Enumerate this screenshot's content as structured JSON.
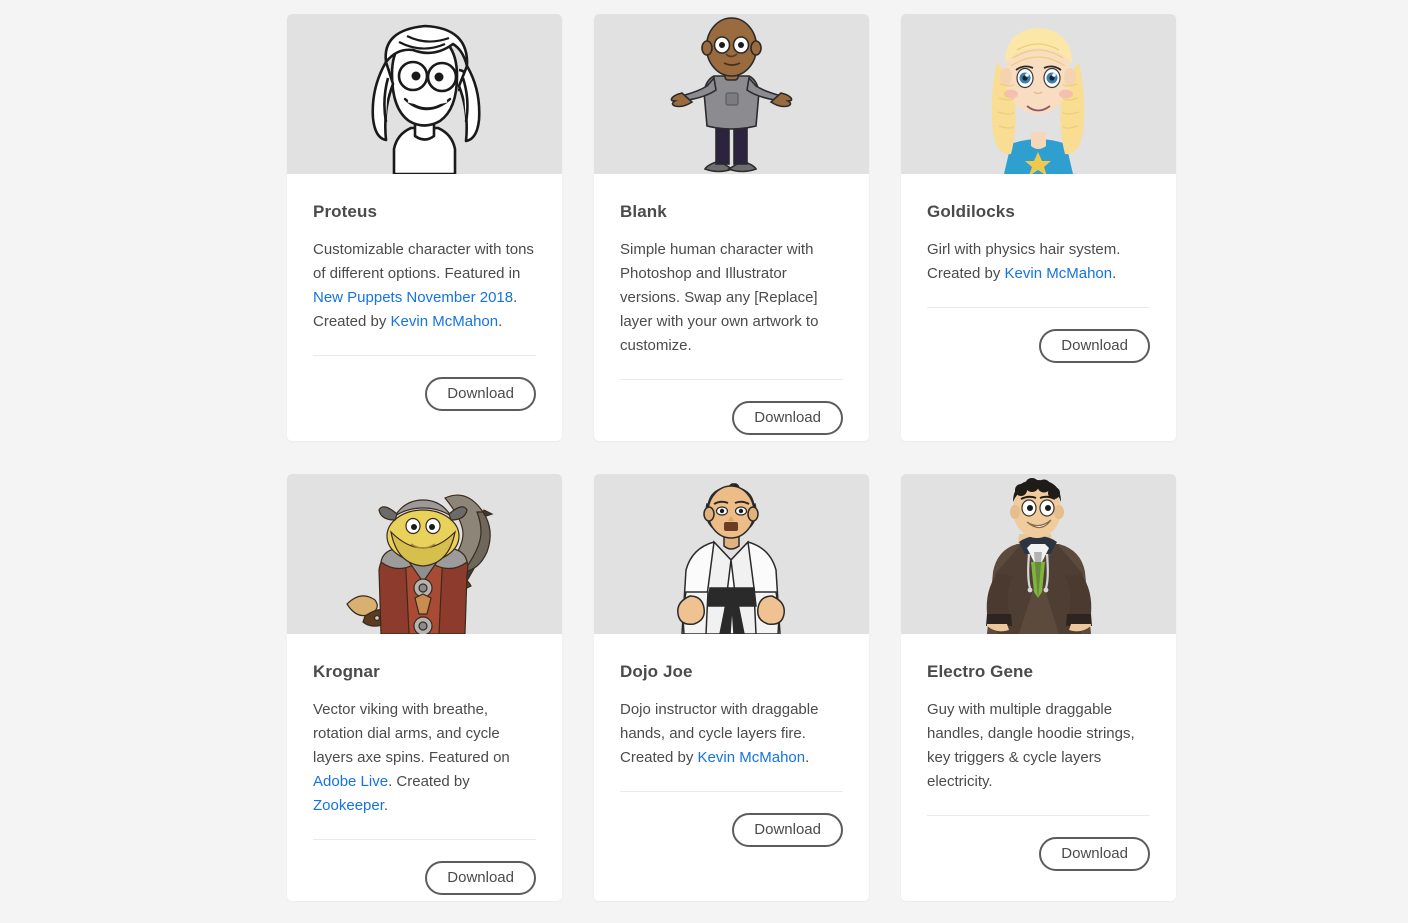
{
  "page": {
    "background_color": "#f4f4f4",
    "card_background_color": "#ffffff",
    "thumbnail_background_color": "#e1e1e1",
    "link_color": "#1473e6",
    "text_color": "#4b4b4b"
  },
  "cards": [
    {
      "title": "Proteus",
      "thumbnail_icon": "proteus-character-thumbnail",
      "description_parts": [
        {
          "type": "text",
          "text": "Customizable character with tons of different options. Featured in "
        },
        {
          "type": "link",
          "text": "New Puppets November 2018"
        },
        {
          "type": "text",
          "text": ". Created by "
        },
        {
          "type": "link",
          "text": "Kevin McMahon"
        },
        {
          "type": "text",
          "text": "."
        }
      ],
      "download_label": "Download"
    },
    {
      "title": "Blank",
      "thumbnail_icon": "blank-character-thumbnail",
      "description_parts": [
        {
          "type": "text",
          "text": "Simple human character with Photoshop and Illustrator versions. Swap any [Replace] layer with your own artwork to customize."
        }
      ],
      "download_label": "Download"
    },
    {
      "title": "Goldilocks",
      "thumbnail_icon": "goldilocks-character-thumbnail",
      "description_parts": [
        {
          "type": "text",
          "text": "Girl with physics hair system. Created by "
        },
        {
          "type": "link",
          "text": "Kevin McMahon"
        },
        {
          "type": "text",
          "text": "."
        }
      ],
      "download_label": "Download"
    },
    {
      "title": "Krognar",
      "thumbnail_icon": "krognar-character-thumbnail",
      "description_parts": [
        {
          "type": "text",
          "text": "Vector viking with breathe, rotation dial arms, and cycle layers axe spins. Featured on "
        },
        {
          "type": "link",
          "text": "Adobe Live"
        },
        {
          "type": "text",
          "text": ". Created by "
        },
        {
          "type": "link",
          "text": "Zookeeper"
        },
        {
          "type": "text",
          "text": "."
        }
      ],
      "download_label": "Download"
    },
    {
      "title": "Dojo Joe",
      "thumbnail_icon": "dojo-joe-character-thumbnail",
      "description_parts": [
        {
          "type": "text",
          "text": "Dojo instructor with draggable hands, and cycle layers fire. Created by "
        },
        {
          "type": "link",
          "text": "Kevin McMahon"
        },
        {
          "type": "text",
          "text": "."
        }
      ],
      "download_label": "Download"
    },
    {
      "title": "Electro Gene",
      "thumbnail_icon": "electro-gene-character-thumbnail",
      "description_parts": [
        {
          "type": "text",
          "text": "Guy with multiple draggable handles, dangle hoodie strings, key triggers & cycle layers electricity."
        }
      ],
      "download_label": "Download"
    }
  ]
}
